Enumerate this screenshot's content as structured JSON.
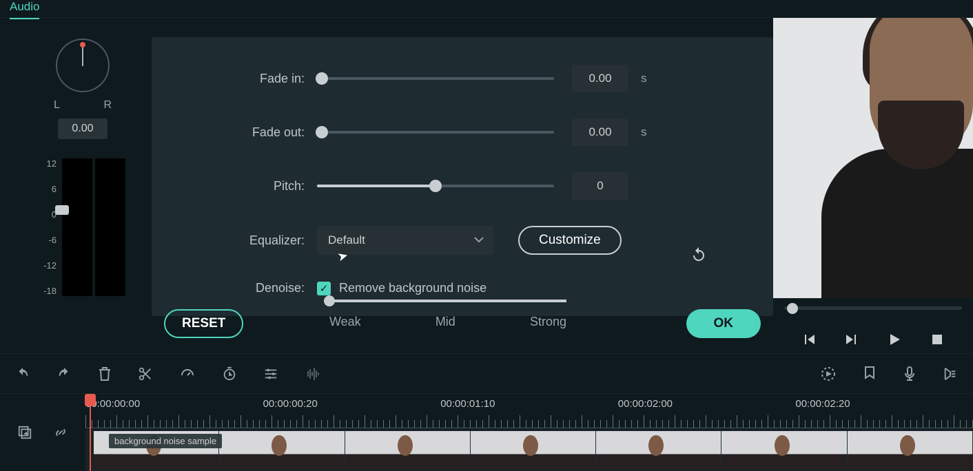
{
  "tab": {
    "active": "Audio"
  },
  "pan": {
    "left_label": "L",
    "right_label": "R",
    "value": "0.00"
  },
  "meter": {
    "ticks": [
      "12",
      "6",
      "0",
      "-6",
      "-12",
      "-18"
    ]
  },
  "audio": {
    "fade_in": {
      "label": "Fade in:",
      "value": "0.00",
      "unit": "s"
    },
    "fade_out": {
      "label": "Fade out:",
      "value": "0.00",
      "unit": "s"
    },
    "pitch": {
      "label": "Pitch:",
      "value": "0"
    },
    "equalizer": {
      "label": "Equalizer:",
      "selected": "Default",
      "customize_btn": "Customize"
    },
    "denoise": {
      "label": "Denoise:",
      "checkbox_label": "Remove background noise",
      "checked": true,
      "marks": {
        "weak": "Weak",
        "mid": "Mid",
        "strong": "Strong"
      }
    }
  },
  "buttons": {
    "reset": "RESET",
    "ok": "OK"
  },
  "timeline": {
    "marks": [
      "00:00:00:00",
      "00:00:00:20",
      "00:00:01:10",
      "00:00:02:00",
      "00:00:02:20"
    ],
    "clip_name": "background noise sample"
  }
}
